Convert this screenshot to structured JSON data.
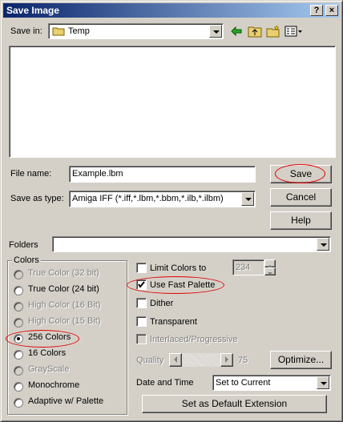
{
  "window": {
    "title": "Save Image",
    "help_btn": "?",
    "close_btn": "×"
  },
  "toolbar": {
    "save_in_label": "Save in:",
    "folder": "Temp"
  },
  "file_name": {
    "label": "File name:",
    "value": "Example.lbm"
  },
  "save_as_type": {
    "label": "Save as type:",
    "value": "Amiga IFF (*.iff,*.lbm,*.bbm,*.ilb,*.ilbm)"
  },
  "buttons": {
    "save": "Save",
    "cancel": "Cancel",
    "help": "Help",
    "optimize": "Optimize...",
    "default_ext": "Set as Default Extension"
  },
  "folders": {
    "label": "Folders",
    "value": ""
  },
  "colors_group": {
    "label": "Colors",
    "options": [
      {
        "label": "True Color (32 bit)",
        "enabled": false,
        "selected": false
      },
      {
        "label": "True Color (24 bit)",
        "enabled": true,
        "selected": false
      },
      {
        "label": "High Color (16 Bit)",
        "enabled": false,
        "selected": false
      },
      {
        "label": "High Color (15 Bit)",
        "enabled": false,
        "selected": false
      },
      {
        "label": "256 Colors",
        "enabled": true,
        "selected": true
      },
      {
        "label": "16 Colors",
        "enabled": true,
        "selected": false
      },
      {
        "label": "GrayScale",
        "enabled": false,
        "selected": false
      },
      {
        "label": "Monochrome",
        "enabled": true,
        "selected": false
      },
      {
        "label": "Adaptive w/ Palette",
        "enabled": true,
        "selected": false
      }
    ]
  },
  "options": {
    "limit_colors": {
      "label": "Limit Colors to",
      "checked": false,
      "value": "234"
    },
    "use_fast_palette": {
      "label": "Use Fast Palette",
      "checked": true
    },
    "dither": {
      "label": "Dither",
      "checked": false
    },
    "transparent": {
      "label": "Transparent",
      "checked": false
    },
    "interlaced": {
      "label": "Interlaced/Progressive",
      "checked": false
    },
    "quality": {
      "label": "Quality",
      "value": "75"
    },
    "date_time": {
      "label": "Date and Time",
      "value": "Set to Current"
    }
  },
  "colors": {
    "title_start": "#0a246a",
    "title_end": "#a6caf0",
    "highlight": "#e00000",
    "face": "#d4d0c8"
  }
}
